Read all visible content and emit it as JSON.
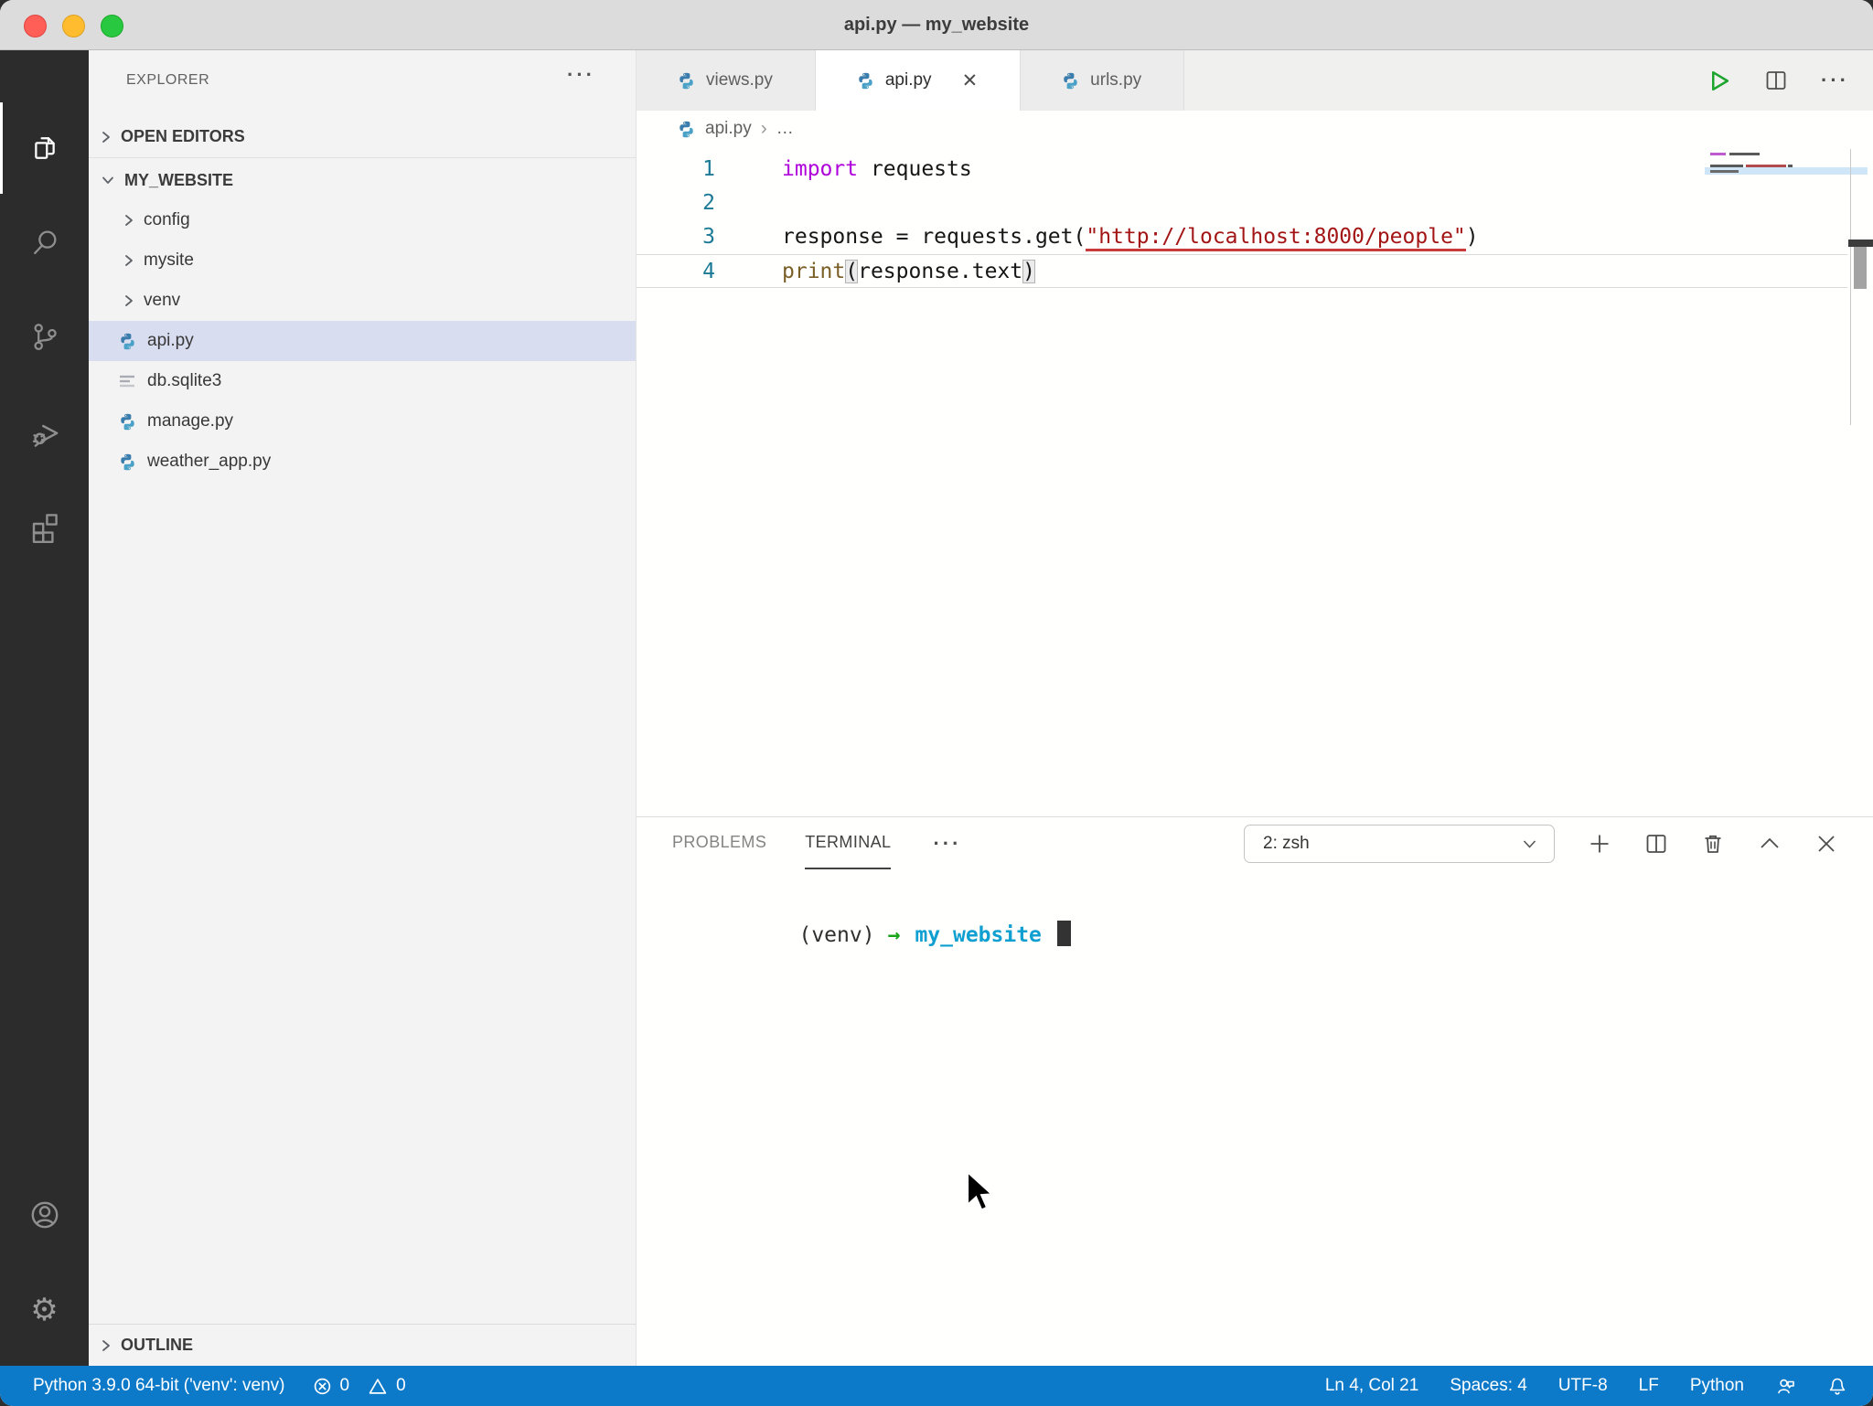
{
  "window": {
    "title": "api.py — my_website"
  },
  "activity_bar": {
    "items": [
      {
        "name": "explorer",
        "active": true
      },
      {
        "name": "search",
        "active": false
      },
      {
        "name": "source-control",
        "active": false
      },
      {
        "name": "run-and-debug",
        "active": false
      },
      {
        "name": "extensions",
        "active": false
      }
    ],
    "bottom_items": [
      {
        "name": "account"
      },
      {
        "name": "settings"
      }
    ]
  },
  "sidebar": {
    "title": "EXPLORER",
    "more_actions": "···",
    "open_editors_label": "OPEN EDITORS",
    "workspace_label": "MY_WEBSITE",
    "outline_label": "OUTLINE",
    "tree": [
      {
        "label": "config",
        "type": "folder"
      },
      {
        "label": "mysite",
        "type": "folder"
      },
      {
        "label": "venv",
        "type": "folder"
      },
      {
        "label": "api.py",
        "type": "python",
        "selected": true
      },
      {
        "label": "db.sqlite3",
        "type": "database"
      },
      {
        "label": "manage.py",
        "type": "python",
        "selected": false
      },
      {
        "label": "weather_app.py",
        "type": "python",
        "selected": false
      }
    ]
  },
  "editor": {
    "tabs": [
      {
        "label": "views.py",
        "icon": "python-icon",
        "active": false,
        "closable": false
      },
      {
        "label": "api.py",
        "icon": "python-icon",
        "active": true,
        "closable": true
      },
      {
        "label": "urls.py",
        "icon": "python-icon",
        "active": false,
        "closable": false
      }
    ],
    "close_glyph": "✕",
    "breadcrumb": {
      "file": "api.py",
      "separator": "›",
      "ellipsis": "…"
    },
    "code_lines": [
      {
        "num": "1",
        "current": false,
        "tokens": [
          {
            "text": "import",
            "style": "keyword"
          },
          {
            "text": " requests",
            "style": "plain"
          }
        ]
      },
      {
        "num": "2",
        "current": false,
        "tokens": []
      },
      {
        "num": "3",
        "current": false,
        "tokens": [
          {
            "text": "response = requests.get(",
            "style": "plain"
          },
          {
            "text": "\"http://localhost:8000/people\"",
            "style": "string-link"
          },
          {
            "text": ")",
            "style": "plain"
          }
        ]
      },
      {
        "num": "4",
        "current": true,
        "tokens": [
          {
            "text": "print",
            "style": "function"
          },
          {
            "text": "(",
            "style": "bracket-match"
          },
          {
            "text": "response.text",
            "style": "plain"
          },
          {
            "text": ")",
            "style": "bracket-match"
          }
        ]
      }
    ]
  },
  "panel": {
    "tabs": [
      {
        "label": "PROBLEMS",
        "active": false
      },
      {
        "label": "TERMINAL",
        "active": true
      }
    ],
    "more_actions": "···",
    "shell_selector": "2: zsh",
    "terminal": {
      "venv_prefix": "(venv)",
      "arrow": "→",
      "cwd": "my_website"
    }
  },
  "status_bar": {
    "interpreter": "Python 3.9.0 64-bit ('venv': venv)",
    "errors": "0",
    "warnings": "0",
    "cursor_position": "Ln 4, Col 21",
    "indentation": "Spaces: 4",
    "encoding": "UTF-8",
    "eol": "LF",
    "language": "Python"
  }
}
